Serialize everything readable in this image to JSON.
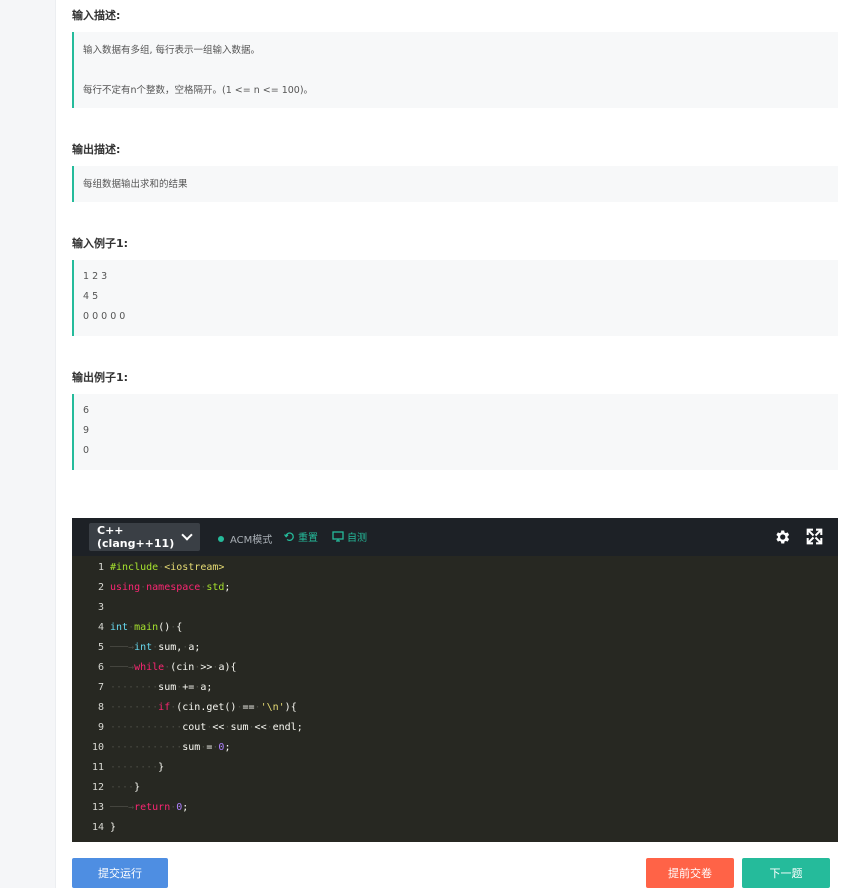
{
  "sections": {
    "input_desc_title": "输入描述:",
    "input_desc_lines": [
      "输入数据有多组, 每行表示一组输入数据。",
      "每行不定有n个整数，空格隔开。(1 <= n <= 100)。"
    ],
    "output_desc_title": "输出描述:",
    "output_desc_lines": [
      "每组数据输出求和的结果"
    ],
    "input_example_title": "输入例子1:",
    "input_example_lines": [
      "1 2 3",
      "4 5",
      "0 0 0 0 0"
    ],
    "output_example_title": "输出例子1:",
    "output_example_lines": [
      "6",
      "9",
      "0"
    ]
  },
  "editor": {
    "language": "C++(clang++11)",
    "mode": "ACM模式",
    "reset_label": "重置",
    "selftest_label": "自测",
    "code": [
      {
        "n": "1",
        "html": "#include <iostream>"
      },
      {
        "n": "2",
        "html": "using namespace std;"
      },
      {
        "n": "3",
        "html": ""
      },
      {
        "n": "4",
        "html": "int main() {"
      },
      {
        "n": "5",
        "html": "    int sum, a;"
      },
      {
        "n": "6",
        "html": "    while (cin >> a){"
      },
      {
        "n": "7",
        "html": "        sum += a;"
      },
      {
        "n": "8",
        "html": "        if (cin.get() == '\\n'){"
      },
      {
        "n": "9",
        "html": "            cout << sum << endl;"
      },
      {
        "n": "10",
        "html": "            sum = 0;"
      },
      {
        "n": "11",
        "html": "        }"
      },
      {
        "n": "12",
        "html": "    }"
      },
      {
        "n": "13",
        "html": "    return 0;"
      },
      {
        "n": "14",
        "html": "}"
      }
    ]
  },
  "buttons": {
    "submit_run": "提交运行",
    "submit_early": "提前交卷",
    "next": "下一题"
  },
  "colors": {
    "accent": "#25bb9b",
    "submit_run": "#4e8ee2",
    "submit_early": "#ff6347",
    "next": "#25bb9b"
  }
}
